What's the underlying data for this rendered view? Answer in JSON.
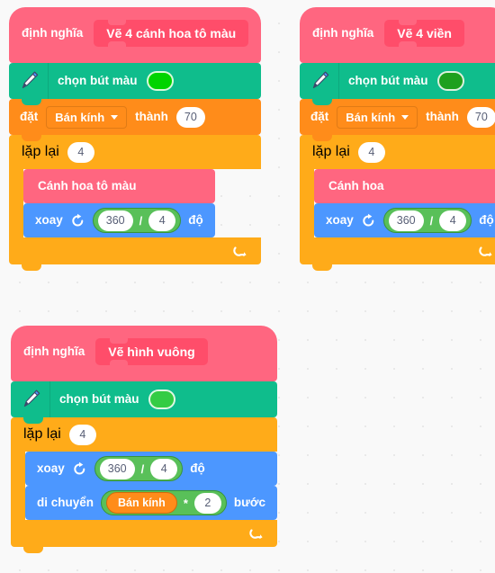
{
  "workspace": {
    "background_color": "#F9F9F9",
    "grid_dot_color": "#E9E9E9"
  },
  "palette": {
    "hat_pink": "#FF6680",
    "hat_proto_pink": "#FF4D6A",
    "pen_green": "#0FBD8C",
    "data_orange": "#FF8C1A",
    "control_orange": "#FFAB19",
    "motion_blue": "#4C97FF",
    "operator_green": "#59C059",
    "text_white": "#FFFFFF",
    "input_text": "#575E75"
  },
  "scripts": [
    {
      "id": "script-ve-4-canh-hoa-to-mau",
      "hat": {
        "keyword": "định nghĩa",
        "prototype": "Vẽ 4 cánh hoa tô màu"
      },
      "pen": {
        "icon": "pen-icon",
        "label": "chọn bút màu",
        "swatch_color": "#00D400"
      },
      "set_var": {
        "keyword": "đặt",
        "variable": "Bán kính",
        "connector": "thành",
        "value": "70"
      },
      "repeat": {
        "label": "lặp lại",
        "times": "4",
        "loop_arrow_icon": "loop-arrow-icon"
      },
      "call": {
        "label": "Cánh hoa tô màu"
      },
      "turn": {
        "label": "xoay",
        "icon": "rotate-clockwise-icon",
        "dividend": "360",
        "operator": "/",
        "divisor": "4",
        "unit": "độ"
      }
    },
    {
      "id": "script-ve-4-vien",
      "hat": {
        "keyword": "định nghĩa",
        "prototype": "Vẽ 4 viền"
      },
      "pen": {
        "icon": "pen-icon",
        "label": "chọn bút màu",
        "swatch_color": "#1EA01E"
      },
      "set_var": {
        "keyword": "đặt",
        "variable": "Bán kính",
        "connector": "thành",
        "value": "70"
      },
      "repeat": {
        "label": "lặp lại",
        "times": "4",
        "loop_arrow_icon": "loop-arrow-icon"
      },
      "call": {
        "label": "Cánh hoa"
      },
      "turn": {
        "label": "xoay",
        "icon": "rotate-clockwise-icon",
        "dividend": "360",
        "operator": "/",
        "divisor": "4",
        "unit": "độ"
      }
    },
    {
      "id": "script-ve-hinh-vuong",
      "hat": {
        "keyword": "định nghĩa",
        "prototype": "Vẽ hình vuông"
      },
      "pen": {
        "icon": "pen-icon",
        "label": "chọn bút màu",
        "swatch_color": "#33CC44"
      },
      "repeat": {
        "label": "lặp lại",
        "times": "4",
        "loop_arrow_icon": "loop-arrow-icon"
      },
      "turn": {
        "label": "xoay",
        "icon": "rotate-clockwise-icon",
        "dividend": "360",
        "operator": "/",
        "divisor": "4",
        "unit": "độ"
      },
      "move": {
        "label": "di chuyển",
        "variable": "Bán kính",
        "operator": "*",
        "factor": "2",
        "unit": "bước"
      }
    }
  ]
}
